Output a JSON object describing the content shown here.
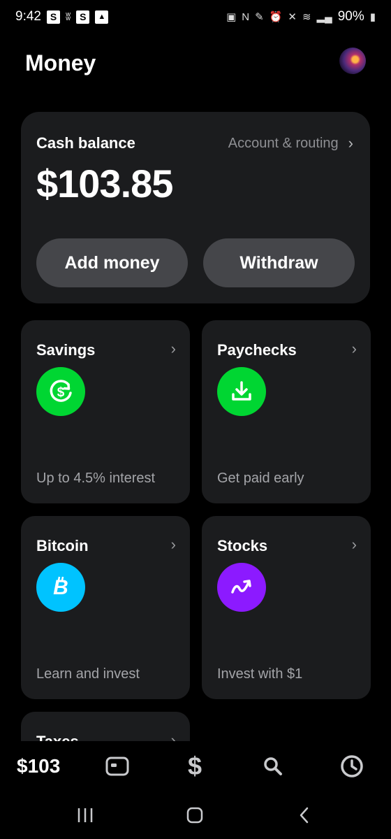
{
  "status_bar": {
    "time": "9:42",
    "battery": "90%"
  },
  "header": {
    "title": "Money"
  },
  "cash_card": {
    "label": "Cash balance",
    "account_link": "Account & routing",
    "amount": "$103.85",
    "add_money_label": "Add money",
    "withdraw_label": "Withdraw"
  },
  "tiles": [
    {
      "title": "Savings",
      "subtitle": "Up to 4.5% interest",
      "icon": "savings-dollar-icon",
      "color": "#00d632"
    },
    {
      "title": "Paychecks",
      "subtitle": "Get paid early",
      "icon": "download-icon",
      "color": "#00d632"
    },
    {
      "title": "Bitcoin",
      "subtitle": "Learn and invest",
      "icon": "bitcoin-icon",
      "color": "#00c3ff"
    },
    {
      "title": "Stocks",
      "subtitle": "Invest with $1",
      "icon": "trend-arrow-icon",
      "color": "#8c1aff"
    },
    {
      "title": "Taxes",
      "subtitle": "",
      "icon": "",
      "color": ""
    }
  ],
  "tab_bar": {
    "balance_label": "$103",
    "items": [
      "balance",
      "card-icon",
      "dollar-icon",
      "search-icon",
      "activity-clock-icon"
    ]
  },
  "colors": {
    "background": "#000000",
    "card": "#1b1c1e",
    "button": "#45464a",
    "green": "#00d632",
    "bitcoin_blue": "#00c3ff",
    "stocks_purple": "#8c1aff"
  }
}
